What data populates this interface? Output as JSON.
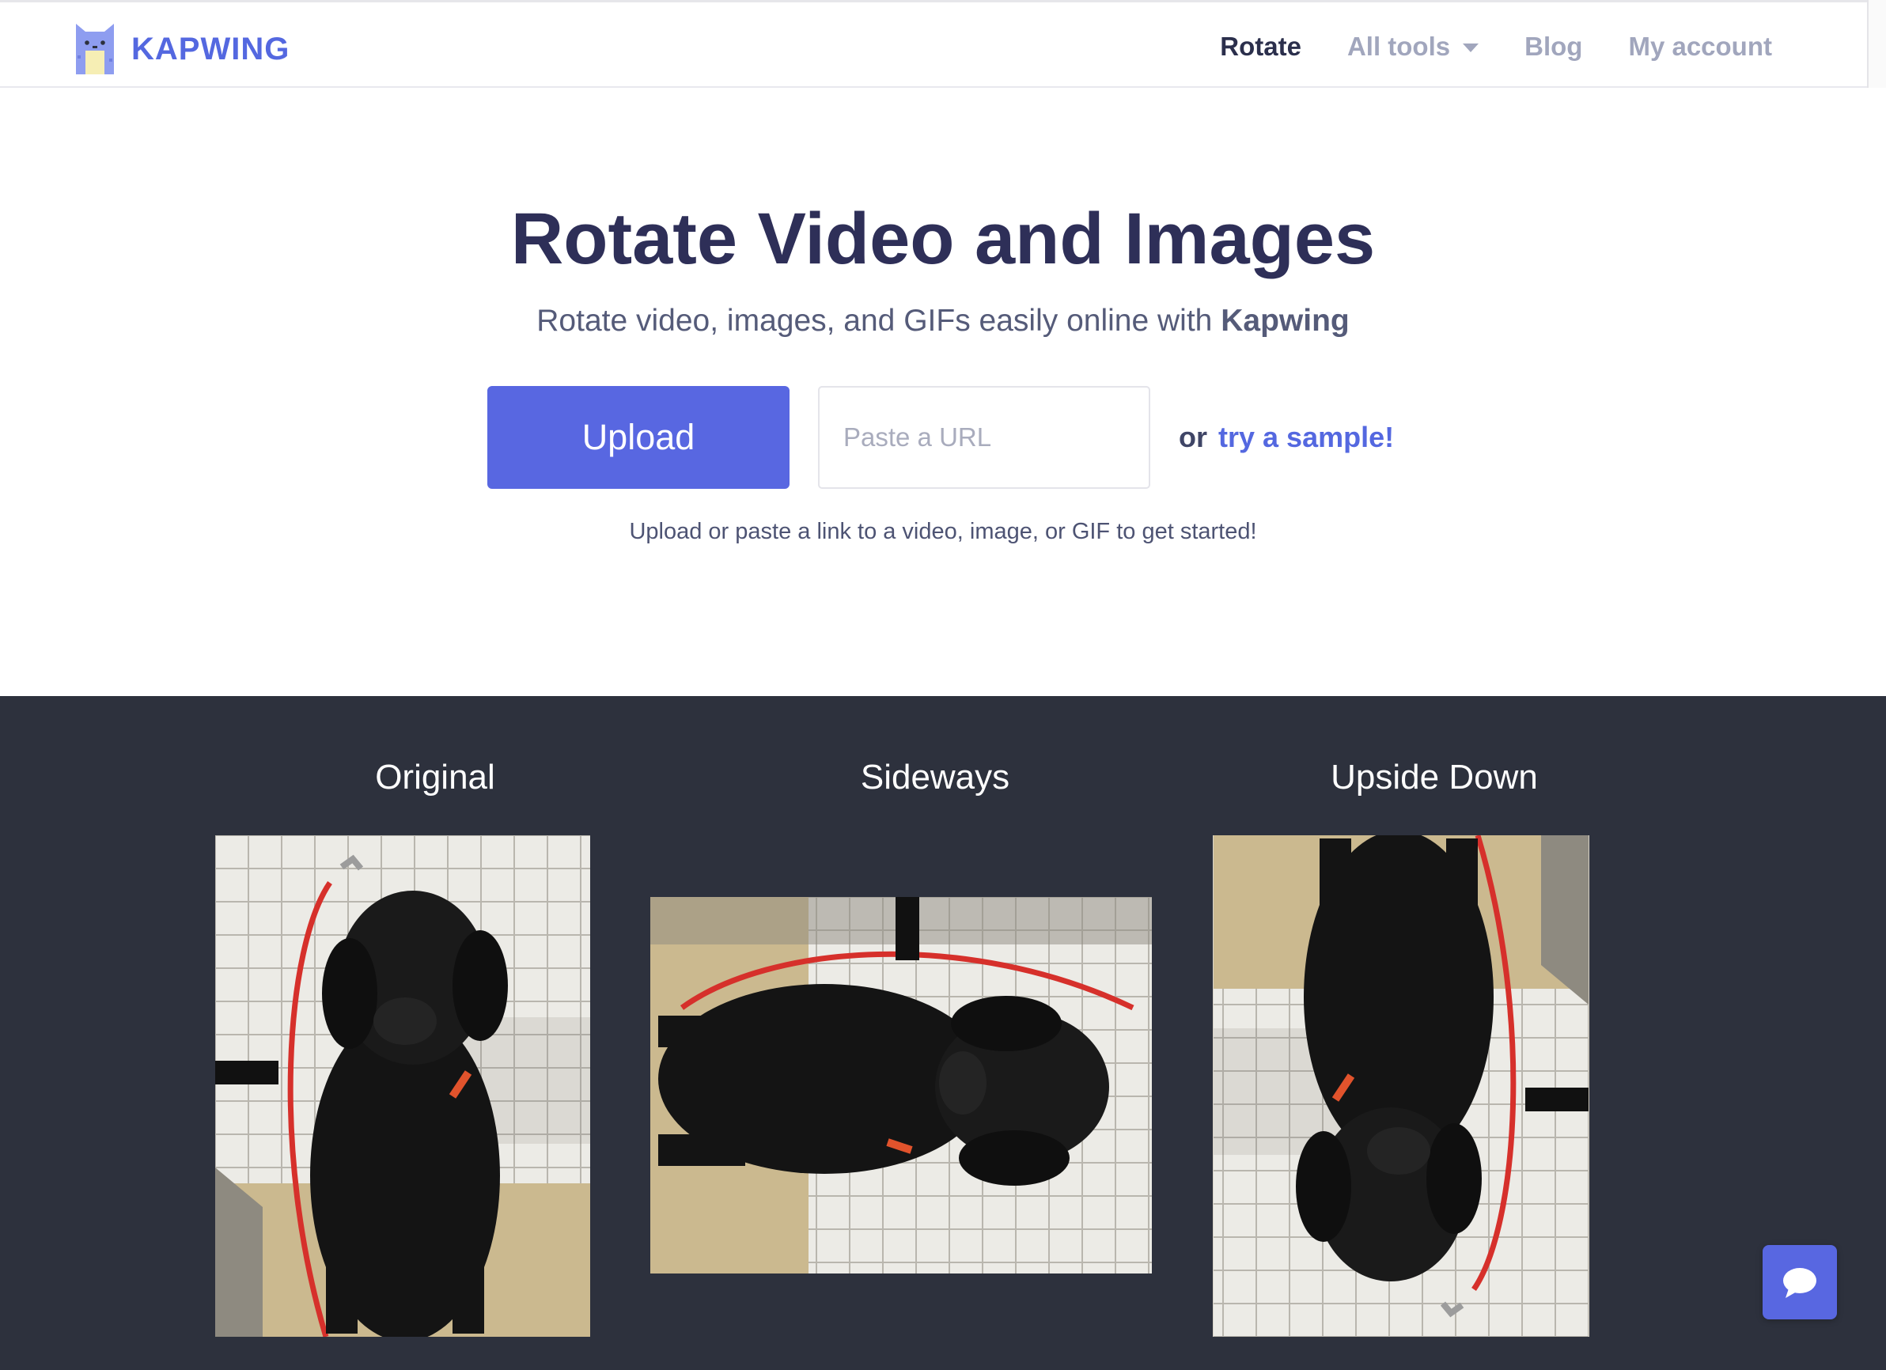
{
  "brand": {
    "name": "KAPWING",
    "logo_icon": "kapwing-cat-logo-icon"
  },
  "nav": {
    "items": [
      {
        "label": "Rotate",
        "active": true
      },
      {
        "label": "All tools",
        "active": false,
        "has_dropdown": true
      },
      {
        "label": "Blog",
        "active": false
      },
      {
        "label": "My account",
        "active": false
      }
    ]
  },
  "hero": {
    "title": "Rotate Video and Images",
    "subtitle_prefix": "Rotate video, images, and GIFs easily online with",
    "subtitle_brand": "Kapwing",
    "upload_label": "Upload",
    "url_placeholder": "Paste a URL",
    "or_text": "or",
    "sample_link": "try a sample!",
    "helper_text": "Upload or paste a link to a video, image, or GIF to get started!"
  },
  "examples": [
    {
      "title": "Original",
      "image": "black-labrador-in-tiled-shower"
    },
    {
      "title": "Sideways",
      "image": "black-labrador-rotated-90-degrees"
    },
    {
      "title": "Upside Down",
      "image": "black-labrador-rotated-180-degrees"
    }
  ],
  "chat": {
    "icon": "chat-bubble-icon"
  },
  "colors": {
    "accent": "#5867e1",
    "brand_text": "#5468e0",
    "heading": "#2e2f58",
    "dark_section": "#2d313d"
  }
}
